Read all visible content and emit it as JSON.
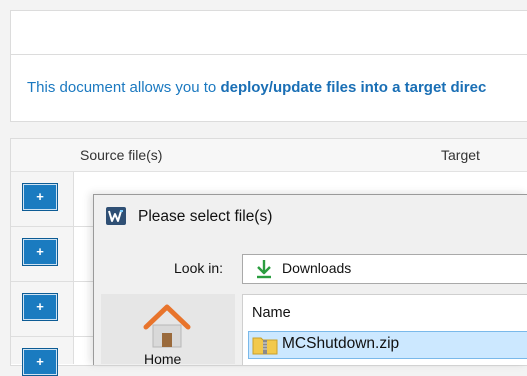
{
  "intro": {
    "text_prefix": "This document allows you to ",
    "text_bold": "deploy/update files into a target direc"
  },
  "table": {
    "columns": [
      "Source file(s)",
      "Target"
    ],
    "add_button_label": "+"
  },
  "dialog": {
    "title": "Please select file(s)",
    "look_in_label": "Look in:",
    "look_in_value": "Downloads",
    "places": [
      "Home"
    ],
    "column_name": "Name",
    "files": [
      "MCShutdown.zip"
    ]
  },
  "colors": {
    "accent": "#1b79c0",
    "button": "#1a7bc0",
    "selection": "#cce8ff",
    "download_icon": "#2a9d3f",
    "home_icon": "#e8742c"
  }
}
